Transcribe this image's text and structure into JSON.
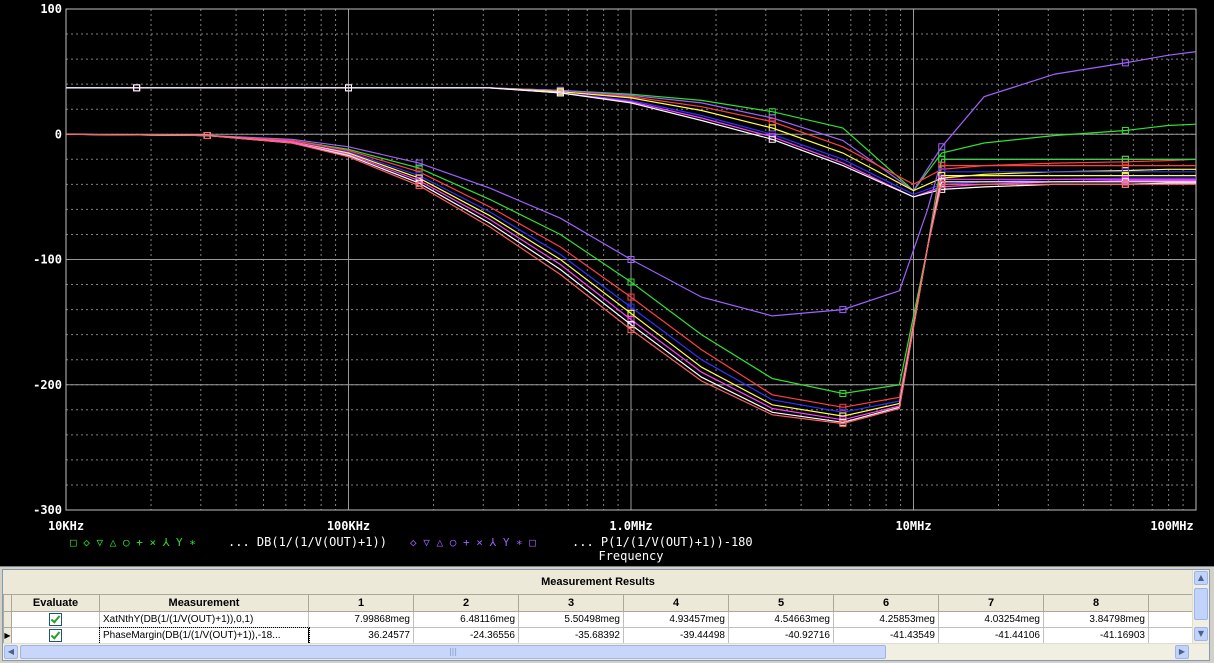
{
  "chart_data": {
    "type": "line",
    "xscale": "log",
    "xlim_hz": [
      10000,
      100000000
    ],
    "ylim": [
      -300,
      100
    ],
    "yticks": [
      100,
      0,
      -100,
      -200,
      -300
    ],
    "ytick_labels": [
      "100",
      "0",
      "-100",
      "-200",
      "-300"
    ],
    "xticks_hz": [
      10000,
      100000,
      1000000,
      10000000,
      100000000
    ],
    "xtick_labels": [
      "10KHz",
      "100KHz",
      "1.0MHz",
      "10MHz",
      "100MHz"
    ],
    "xlabel": "Frequency",
    "grid": true,
    "legend": [
      {
        "markers": "□ ◇ ▽ △ ○ + × ⅄ Y ∗",
        "expr": "... DB(1/(1/V(OUT)+1))"
      },
      {
        "markers": "◇ ▽ △ ○ + × ⅄ Y ∗ □",
        "expr": "... P(1/(1/V(OUT)+1))-180"
      }
    ],
    "series_colors": [
      "#30e030",
      "#ff4040",
      "#3030ff",
      "#ffff40",
      "#ff40ff",
      "#40ffff",
      "#ff6060",
      "#a060ff",
      "#ffffff",
      "#ff40c0",
      "#8fd0ff",
      "#ffd060"
    ],
    "magnitude_series": [
      {
        "color": "#a060ff",
        "y": [
          0,
          -1,
          -4,
          -10,
          -23,
          -43,
          -67,
          -100,
          -130,
          -145,
          -140,
          -125,
          -60,
          -20,
          -20,
          -20,
          -20,
          -20,
          -20
        ]
      },
      {
        "color": "#30e030",
        "y": [
          0,
          -1,
          -5,
          -12,
          -27,
          -52,
          -80,
          -118,
          -160,
          -195,
          -207,
          -200,
          -90,
          -20,
          -20,
          -20,
          -20,
          -20,
          -20
        ]
      },
      {
        "color": "#ff4040",
        "y": [
          0,
          -1,
          -5,
          -13,
          -30,
          -58,
          -90,
          -130,
          -172,
          -208,
          -218,
          -210,
          -90,
          -25,
          -25,
          -25,
          -25,
          -25,
          -25
        ]
      },
      {
        "color": "#3030ff",
        "y": [
          0,
          -1,
          -6,
          -14,
          -33,
          -62,
          -96,
          -138,
          -180,
          -212,
          -222,
          -213,
          -90,
          -30,
          -30,
          -30,
          -30,
          -30,
          -30
        ]
      },
      {
        "color": "#ffff40",
        "y": [
          0,
          -1,
          -6,
          -15,
          -35,
          -65,
          -100,
          -143,
          -186,
          -216,
          -225,
          -215,
          -90,
          -33,
          -33,
          -33,
          -33,
          -33,
          -33
        ]
      },
      {
        "color": "#ff40ff",
        "y": [
          0,
          -1,
          -6,
          -16,
          -37,
          -68,
          -104,
          -148,
          -190,
          -219,
          -228,
          -217,
          -90,
          -36,
          -36,
          -36,
          -36,
          -36,
          -36
        ]
      },
      {
        "color": "#ffffff",
        "y": [
          0,
          -1,
          -7,
          -17,
          -39,
          -71,
          -108,
          -152,
          -194,
          -222,
          -230,
          -218,
          -90,
          -38,
          -38,
          -38,
          -38,
          -38,
          -38
        ]
      },
      {
        "color": "#ff6060",
        "y": [
          0,
          -1,
          -7,
          -18,
          -41,
          -74,
          -112,
          -156,
          -197,
          -224,
          -231,
          -219,
          -90,
          -40,
          -40,
          -40,
          -40,
          -40,
          -40
        ]
      }
    ],
    "phase_series": [
      {
        "color": "#30e030",
        "y": [
          37,
          37,
          37,
          37,
          37,
          37,
          37,
          35,
          32,
          27,
          18,
          5,
          -45,
          -15,
          -7,
          -1,
          3,
          7,
          8
        ]
      },
      {
        "color": "#a060ff",
        "y": [
          37,
          37,
          37,
          37,
          37,
          37,
          37,
          35,
          31,
          25,
          13,
          -5,
          -45,
          -10,
          30,
          48,
          57,
          63,
          66
        ]
      },
      {
        "color": "#ff4040",
        "y": [
          37,
          37,
          37,
          37,
          37,
          37,
          37,
          34,
          30,
          22,
          10,
          -10,
          -40,
          -28,
          -25,
          -23,
          -22,
          -21,
          -20
        ]
      },
      {
        "color": "#ffff40",
        "y": [
          37,
          37,
          37,
          37,
          37,
          37,
          37,
          34,
          29,
          19,
          5,
          -15,
          -45,
          -35,
          -32,
          -30,
          -29,
          -28,
          -28
        ]
      },
      {
        "color": "#3030ff",
        "y": [
          37,
          37,
          37,
          37,
          37,
          37,
          37,
          33,
          27,
          15,
          0,
          -20,
          -48,
          -40,
          -38,
          -36,
          -35,
          -35,
          -35
        ]
      },
      {
        "color": "#ff40ff",
        "y": [
          37,
          37,
          37,
          37,
          37,
          37,
          37,
          33,
          26,
          13,
          -2,
          -23,
          -50,
          -42,
          -40,
          -38,
          -37,
          -37,
          -37
        ]
      },
      {
        "color": "#ffffff",
        "y": [
          37,
          37,
          37,
          37,
          37,
          37,
          37,
          33,
          25,
          11,
          -4,
          -25,
          -50,
          -44,
          -42,
          -40,
          -40,
          -39,
          -39
        ]
      }
    ],
    "phase_x_points_log": [
      4,
      4.25,
      4.5,
      4.75,
      5,
      5.25,
      5.5,
      5.75,
      6,
      6.25,
      6.5,
      6.75,
      7,
      7.1,
      7.25,
      7.5,
      7.75,
      7.9,
      8
    ],
    "mag_x_points_log": [
      4,
      4.5,
      4.8,
      5,
      5.25,
      5.5,
      5.75,
      6,
      6.25,
      6.5,
      6.75,
      6.95,
      7.05,
      7.1,
      7.25,
      7.5,
      7.75,
      7.9,
      8
    ]
  },
  "results": {
    "title": "Measurement Results",
    "columns": [
      "Evaluate",
      "Measurement",
      "1",
      "2",
      "3",
      "4",
      "5",
      "6",
      "7",
      "8"
    ],
    "rows": [
      {
        "checked": true,
        "measurement": "XatNthY(DB(1/(1/V(OUT)+1)),0,1)",
        "values": [
          "7.99868meg",
          "6.48116meg",
          "5.50498meg",
          "4.93457meg",
          "4.54663meg",
          "4.25853meg",
          "4.03254meg",
          "3.84798meg"
        ]
      },
      {
        "checked": true,
        "measurement": "PhaseMargin(DB(1/(1/V(OUT)+1)),-18...",
        "values": [
          "36.24577",
          "-24.36556",
          "-35.68392",
          "-39.44498",
          "-40.92716",
          "-41.43549",
          "-41.44106",
          "-41.16903"
        ]
      }
    ]
  },
  "colors": {
    "plot_bg": "#000000",
    "grid": "#808080",
    "axis_text": "#ffffff",
    "legend_text": "#ffffff",
    "panel_bg": "#d4d0c8"
  }
}
